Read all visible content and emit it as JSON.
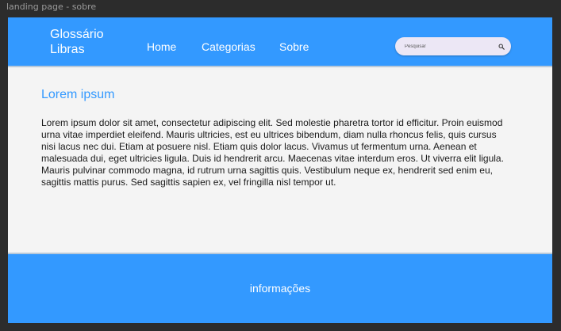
{
  "frame_label": "landing page - sobre",
  "header": {
    "logo_line1": "Glossário",
    "logo_line2": "Libras",
    "nav": [
      {
        "label": "Home"
      },
      {
        "label": "Categorias"
      },
      {
        "label": "Sobre"
      }
    ],
    "search": {
      "placeholder": "Pesquisar",
      "value": "",
      "icon": "search-icon"
    }
  },
  "main": {
    "title": "Lorem ipsum",
    "body": "Lorem ipsum dolor sit amet, consectetur adipiscing elit. Sed molestie pharetra tortor id efficitur. Proin euismod urna vitae imperdiet eleifend. Mauris ultricies, est eu ultrices bibendum, diam nulla rhoncus felis, quis cursus nisi lacus nec dui. Etiam at posuere nisl. Etiam quis dolor lacus. Vivamus ut fermentum urna. Aenean et malesuada dui, eget ultricies ligula. Duis id hendrerit arcu. Maecenas vitae interdum eros. Ut viverra elit ligula. Mauris pulvinar commodo magna, id rutrum urna sagittis quis. Vestibulum neque ex, hendrerit sed enim eu, sagittis mattis purus. Sed sagittis sapien ex, vel fringilla nisl tempor ut."
  },
  "footer": {
    "text": "informações"
  },
  "colors": {
    "primary": "#3399ff",
    "background": "#f4f4f4",
    "text": "#1a1a1a"
  }
}
